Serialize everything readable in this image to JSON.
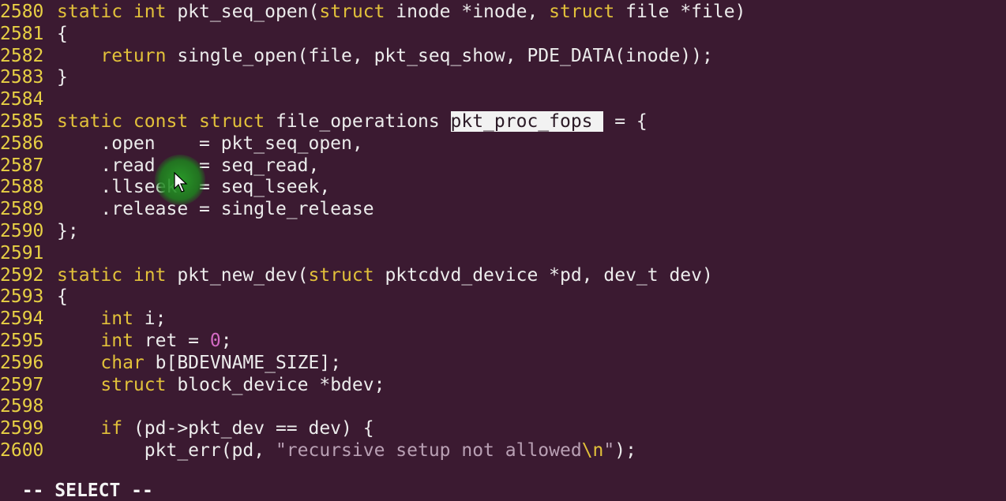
{
  "editor": {
    "lines": [
      {
        "n": "2580",
        "segs": [
          {
            "c": "kw",
            "t": "static int "
          },
          {
            "c": "txt",
            "t": "pkt_seq_open("
          },
          {
            "c": "kw",
            "t": "struct "
          },
          {
            "c": "txt",
            "t": "inode *inode, "
          },
          {
            "c": "kw",
            "t": "struct "
          },
          {
            "c": "txt",
            "t": "file *file)"
          }
        ]
      },
      {
        "n": "2581",
        "segs": [
          {
            "c": "txt",
            "t": "{"
          }
        ]
      },
      {
        "n": "2582",
        "segs": [
          {
            "c": "txt",
            "t": "    "
          },
          {
            "c": "kw",
            "t": "return "
          },
          {
            "c": "txt",
            "t": "single_open(file, pkt_seq_show, PDE_DATA(inode));"
          }
        ]
      },
      {
        "n": "2583",
        "segs": [
          {
            "c": "txt",
            "t": "}"
          }
        ]
      },
      {
        "n": "2584",
        "segs": []
      },
      {
        "n": "2585",
        "segs": [
          {
            "c": "kw",
            "t": "static const struct "
          },
          {
            "c": "txt",
            "t": "file_operations "
          },
          {
            "c": "sel",
            "t": "pkt_proc_fops "
          },
          {
            "c": "txt",
            "t": " = {"
          }
        ]
      },
      {
        "n": "2586",
        "segs": [
          {
            "c": "txt",
            "t": "    .open    = pkt_seq_open,"
          }
        ]
      },
      {
        "n": "2587",
        "segs": [
          {
            "c": "txt",
            "t": "    .read    = seq_read,"
          }
        ]
      },
      {
        "n": "2588",
        "segs": [
          {
            "c": "txt",
            "t": "    .llseek  = seq_lseek,"
          }
        ]
      },
      {
        "n": "2589",
        "segs": [
          {
            "c": "txt",
            "t": "    .release = single_release"
          }
        ]
      },
      {
        "n": "2590",
        "segs": [
          {
            "c": "txt",
            "t": "};"
          }
        ]
      },
      {
        "n": "2591",
        "segs": []
      },
      {
        "n": "2592",
        "segs": [
          {
            "c": "kw",
            "t": "static int "
          },
          {
            "c": "txt",
            "t": "pkt_new_dev("
          },
          {
            "c": "kw",
            "t": "struct "
          },
          {
            "c": "txt",
            "t": "pktcdvd_device *pd, dev_t dev)"
          }
        ]
      },
      {
        "n": "2593",
        "segs": [
          {
            "c": "txt",
            "t": "{"
          }
        ]
      },
      {
        "n": "2594",
        "segs": [
          {
            "c": "txt",
            "t": "    "
          },
          {
            "c": "kw",
            "t": "int "
          },
          {
            "c": "txt",
            "t": "i;"
          }
        ]
      },
      {
        "n": "2595",
        "segs": [
          {
            "c": "txt",
            "t": "    "
          },
          {
            "c": "kw",
            "t": "int "
          },
          {
            "c": "txt",
            "t": "ret = "
          },
          {
            "c": "num",
            "t": "0"
          },
          {
            "c": "txt",
            "t": ";"
          }
        ]
      },
      {
        "n": "2596",
        "segs": [
          {
            "c": "txt",
            "t": "    "
          },
          {
            "c": "kw",
            "t": "char "
          },
          {
            "c": "txt",
            "t": "b[BDEVNAME_SIZE];"
          }
        ]
      },
      {
        "n": "2597",
        "segs": [
          {
            "c": "txt",
            "t": "    "
          },
          {
            "c": "kw",
            "t": "struct "
          },
          {
            "c": "txt",
            "t": "block_device *bdev;"
          }
        ]
      },
      {
        "n": "2598",
        "segs": []
      },
      {
        "n": "2599",
        "segs": [
          {
            "c": "txt",
            "t": "    "
          },
          {
            "c": "kw",
            "t": "if "
          },
          {
            "c": "txt",
            "t": "(pd->pkt_dev == dev) {"
          }
        ]
      },
      {
        "n": "2600",
        "segs": [
          {
            "c": "txt",
            "t": "        pkt_err(pd, "
          },
          {
            "c": "str",
            "t": "\"recursive setup not allowed"
          },
          {
            "c": "kw",
            "t": "\\n"
          },
          {
            "c": "str",
            "t": "\""
          },
          {
            "c": "txt",
            "t": ");"
          }
        ]
      }
    ]
  },
  "statusbar": {
    "mode": "-- SELECT --"
  },
  "icons": {
    "cursor": "mouse-pointer-icon"
  },
  "colors": {
    "background": "#3b1a31",
    "line_number": "#e8d044",
    "keyword": "#e2c13a",
    "string": "#b9a0b4",
    "number": "#d46ac4",
    "selection_bg": "#f2f2f2"
  }
}
